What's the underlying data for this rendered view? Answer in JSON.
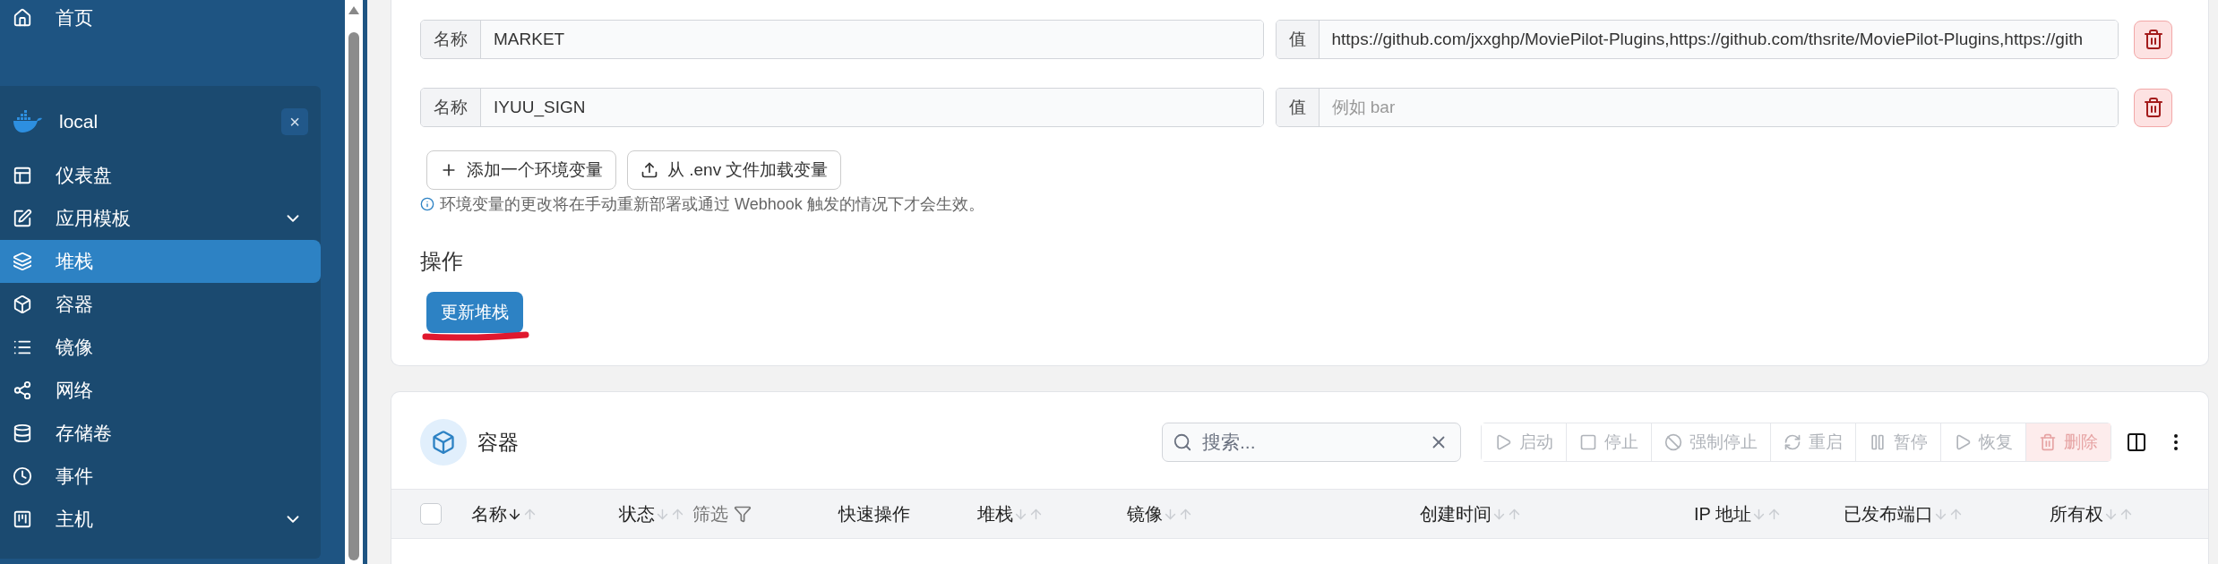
{
  "sidebar": {
    "home": {
      "label": "首页"
    },
    "environment": {
      "name": "local",
      "close": "×"
    },
    "items": [
      {
        "label": "仪表盘",
        "selected": false
      },
      {
        "label": "应用模板",
        "selected": false,
        "expanded": false
      },
      {
        "label": "堆栈",
        "selected": true
      },
      {
        "label": "容器",
        "selected": false
      },
      {
        "label": "镜像",
        "selected": false
      },
      {
        "label": "网络",
        "selected": false
      },
      {
        "label": "存储卷",
        "selected": false
      },
      {
        "label": "事件",
        "selected": false
      },
      {
        "label": "主机",
        "selected": false,
        "expanded": false
      }
    ]
  },
  "env_vars": {
    "rows": [
      {
        "name_label": "名称",
        "name": "MARKET",
        "value_label": "值",
        "value": "https://github.com/jxxghp/MoviePilot-Plugins,https://github.com/thsrite/MoviePilot-Plugins,https://gith"
      },
      {
        "name_label": "名称",
        "name": "IYUU_SIGN",
        "value_label": "值",
        "value_placeholder": "例如 bar"
      }
    ],
    "buttons": [
      {
        "kind": "add",
        "label": "添加一个环境变量"
      },
      {
        "kind": "upload",
        "label": "从 .env 文件加载变量"
      }
    ],
    "note": "环境变量的更改将在手动重新部署或通过 Webhook 触发的情况下才会生效。"
  },
  "actions": {
    "title": "操作",
    "button": "更新堆栈"
  },
  "containers": {
    "title": "容器",
    "search": {
      "placeholder": "搜索..."
    },
    "toolbar": [
      {
        "kind": "start",
        "label": "启动",
        "disabled": true
      },
      {
        "kind": "stop",
        "label": "停止",
        "disabled": true
      },
      {
        "kind": "kill",
        "label": "强制停止",
        "disabled": true
      },
      {
        "kind": "restart",
        "label": "重启",
        "disabled": true
      },
      {
        "kind": "pause",
        "label": "暂停",
        "disabled": true
      },
      {
        "kind": "resume",
        "label": "恢复",
        "disabled": true
      },
      {
        "kind": "delete",
        "label": "删除",
        "disabled": true
      }
    ],
    "select_all": {
      "checked": false
    },
    "columns": [
      {
        "label": "名称",
        "sorted": true
      },
      {
        "label": "状态",
        "sorted": false,
        "filter": "筛选"
      },
      {
        "label": "快速操作"
      },
      {
        "label": "堆栈",
        "sorted": false
      },
      {
        "label": "镜像",
        "sorted": false
      },
      {
        "label": "创建时间",
        "sorted": false
      },
      {
        "label": "IP 地址",
        "sorted": false
      },
      {
        "label": "已发布端口",
        "sorted": false
      },
      {
        "label": "所有权",
        "sorted": false
      }
    ]
  }
}
